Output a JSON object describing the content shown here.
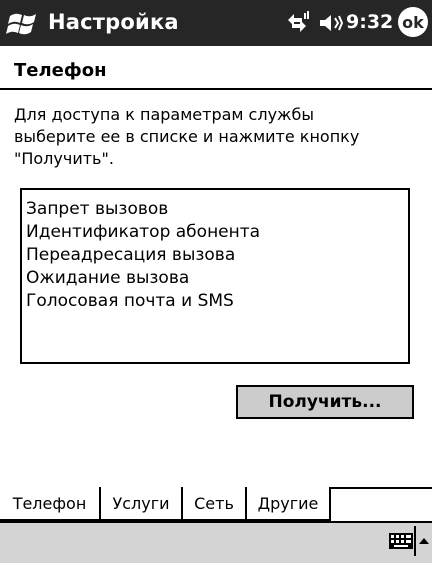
{
  "titlebar": {
    "title": "Настройка",
    "time": "9:32",
    "ok_label": "ok",
    "start_icon": "windows-flag-icon",
    "connectivity_icon": "connectivity-icon",
    "volume_icon": "volume-icon"
  },
  "page": {
    "title": "Телефон",
    "instructions": "Для доступа к параметрам службы\nвыберите ее в списке и нажмите кнопку\n\"Получить\"."
  },
  "services": {
    "items": [
      "Запрет вызовов",
      "Идентификатор абонента",
      "Переадресация вызова",
      "Ожидание вызова",
      "Голосовая почта и SMS"
    ]
  },
  "get_button": {
    "label": "Получить..."
  },
  "tabs": [
    {
      "label": "Телефон",
      "active": false
    },
    {
      "label": "Услуги",
      "active": true
    },
    {
      "label": "Сеть",
      "active": false
    },
    {
      "label": "Другие",
      "active": false
    }
  ],
  "menubar": {
    "keyboard_icon": "keyboard-icon",
    "sip_arrow_icon": "up-arrow-icon"
  },
  "colors": {
    "titlebar_bg": "#262626",
    "menubar_bg": "#d4d4d4",
    "button_bg": "#cccccc"
  }
}
